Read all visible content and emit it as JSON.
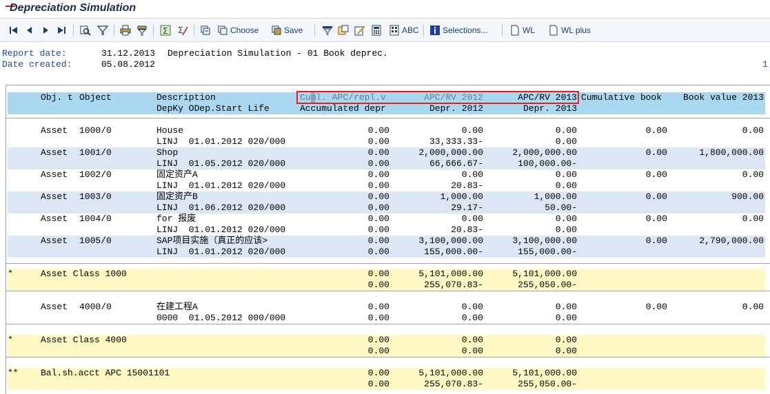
{
  "window": {
    "title": "Depreciation Simulation"
  },
  "toolbar": {
    "choose_label": "Choose",
    "save_label": "Save",
    "abc_label": "ABC",
    "selections_label": "Selections...",
    "wl_label": "WL",
    "wl_plus_label": "WL plus"
  },
  "header": {
    "report_date_label": "Report date:",
    "report_date_value": "31.12.2013",
    "report_title": "Depreciation Simulation - 01 Book deprec.",
    "date_created_label": "Date created:",
    "date_created_value": "05.08.2012",
    "page_number": "1"
  },
  "columns": {
    "h1": {
      "obj": "Obj. t",
      "object": "Object",
      "description": "Description",
      "cuml_apc": "Cuml. APC/repl.v",
      "apc_rv_prev": "APC/RV 2012",
      "apc_rv_curr": "APC/RV 2013",
      "cumulative_book": "Cumulative book",
      "book_value": "Book value 2013"
    },
    "h2": {
      "depky": "DepKy ODep.Start Life",
      "accumulated_depr": "Accumulated depr",
      "depr_prev": "Depr. 2012",
      "depr_curr": "Depr. 2013"
    }
  },
  "rows": [
    {
      "type": "line",
      "style": "white",
      "obj": "Asset",
      "object": "1000/0",
      "desc": "House",
      "c1": "0.00",
      "c2": "0.00",
      "c3": "0.00",
      "c4": "0.00",
      "c5": "0.00"
    },
    {
      "type": "line",
      "style": "white",
      "desc": "LINJ  01.01.2012 020/000",
      "c1": "0.00",
      "c2": "33,333.33-",
      "c3": "0.00"
    },
    {
      "type": "line",
      "style": "blue",
      "obj": "Asset",
      "object": "1001/0",
      "desc": "Shop",
      "c1": "0.00",
      "c2": "2,000,000.00",
      "c3": "2,000,000.00",
      "c4": "0.00",
      "c5": "1,800,000.00"
    },
    {
      "type": "line",
      "style": "blue",
      "desc": "LINJ  01.05.2012 020/000",
      "c1": "0.00",
      "c2": "66,666.67-",
      "c3": "100,000.00-"
    },
    {
      "type": "line",
      "style": "white",
      "obj": "Asset",
      "object": "1002/0",
      "desc": "固定资产A",
      "c1": "0.00",
      "c2": "0.00",
      "c3": "0.00",
      "c4": "0.00",
      "c5": "0.00"
    },
    {
      "type": "line",
      "style": "white",
      "desc": "LINJ  01.01.2012 020/000",
      "c1": "0.00",
      "c2": "20.83-",
      "c3": "0.00"
    },
    {
      "type": "line",
      "style": "blue",
      "obj": "Asset",
      "object": "1003/0",
      "desc": "固定资产B",
      "c1": "0.00",
      "c2": "1,000.00",
      "c3": "1,000.00",
      "c4": "0.00",
      "c5": "900.00"
    },
    {
      "type": "line",
      "style": "blue",
      "desc": "LINJ  01.06.2012 020/000",
      "c1": "0.00",
      "c2": "29.17-",
      "c3": "50.00-"
    },
    {
      "type": "line",
      "style": "white",
      "obj": "Asset",
      "object": "1004/0",
      "desc": "for 报废",
      "c1": "0.00",
      "c2": "0.00",
      "c3": "0.00",
      "c4": "0.00",
      "c5": "0.00"
    },
    {
      "type": "line",
      "style": "white",
      "desc": "LINJ  01.01.2012 020/000",
      "c1": "0.00",
      "c2": "20.83-",
      "c3": "0.00"
    },
    {
      "type": "line",
      "style": "blue",
      "obj": "Asset",
      "object": "1005/0",
      "desc": "SAP项目实施（真正的应该>",
      "c1": "0.00",
      "c2": "3,100,000.00",
      "c3": "3,100,000.00",
      "c4": "0.00",
      "c5": "2,790,000.00"
    },
    {
      "type": "line",
      "style": "blue",
      "desc": "LINJ  01.01.2012 020/000",
      "c1": "0.00",
      "c2": "155,000.00-",
      "c3": "155,000.00-"
    },
    {
      "type": "sum",
      "style": "yellow",
      "mark": "*",
      "obj": "Asset Class 1000",
      "c1": "0.00",
      "c2": "5,101,000.00",
      "c3": "5,101,000.00"
    },
    {
      "type": "sum",
      "style": "yellow",
      "c1": "0.00",
      "c2": "255,070.83-",
      "c3": "255,050.00-"
    },
    {
      "type": "line",
      "style": "white",
      "obj": "Asset",
      "object": "4000/0",
      "desc": "在建工程A",
      "c1": "0.00",
      "c2": "0.00",
      "c3": "0.00",
      "c4": "0.00",
      "c5": "0.00"
    },
    {
      "type": "line",
      "style": "white",
      "desc": "0000  01.05.2012 000/000",
      "c1": "0.00",
      "c2": "0.00",
      "c3": "0.00"
    },
    {
      "type": "sum",
      "style": "yellow",
      "mark": "*",
      "obj": "Asset Class 4000",
      "c1": "0.00",
      "c2": "0.00",
      "c3": "0.00"
    },
    {
      "type": "sum",
      "style": "yellow",
      "c1": "0.00",
      "c2": "0.00",
      "c3": "0.00"
    },
    {
      "type": "sum",
      "style": "yellow",
      "mark": "**",
      "obj": "Bal.sh.acct APC 15001101",
      "c1": "0.00",
      "c2": "5,101,000.00",
      "c3": "5,101,000.00"
    },
    {
      "type": "sum",
      "style": "yellow",
      "c1": "0.00",
      "c2": "255,070.83-",
      "c3": "255,050.00-"
    }
  ],
  "colors": {
    "header_row": "#a9d8f0",
    "alt_row": "#dde6f4",
    "sum_row": "#fffac4",
    "highlight": "#e02020"
  }
}
